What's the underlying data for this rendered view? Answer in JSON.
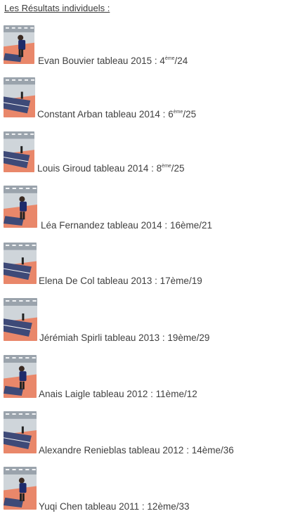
{
  "section": {
    "title": "Les Résultats individuels :"
  },
  "results": [
    {
      "name": "Evan Bouvier",
      "category": "tableau 2015",
      "rank": "4",
      "rank_suffix": "ème",
      "total": "/24",
      "photo": "player-photo"
    },
    {
      "name": "Constant Arban",
      "category": "tableau 2014",
      "rank": "6",
      "rank_suffix": "ème",
      "total": "/25",
      "photo": "table-photo"
    },
    {
      "name": "Louis Giroud",
      "category": "tableau 2014",
      "rank": "8",
      "rank_suffix": "ème",
      "total": "/25",
      "photo": "table-photo"
    },
    {
      "name": "Léa Fernandez",
      "category": "tableau 2014",
      "rank": "16ème",
      "rank_suffix": "",
      "total": "/21",
      "photo": "player-photo"
    },
    {
      "name": "Elena De Col",
      "category": "tableau 2013",
      "rank": "17ème",
      "rank_suffix": "",
      "total": "/19",
      "photo": "hall-photo"
    },
    {
      "name": "Jérémiah Spirli",
      "category": "tableau 2013",
      "rank": "19ème",
      "rank_suffix": "",
      "total": "/29",
      "photo": "hall-photo"
    },
    {
      "name": "Anais Laigle",
      "category": "tableau 2012",
      "rank": "11ème",
      "rank_suffix": "",
      "total": "/12",
      "photo": "player-photo"
    },
    {
      "name": "Alexandre Renieblas",
      "category": "tableau 2012",
      "rank": "14ème",
      "rank_suffix": "",
      "total": "/36",
      "photo": "hall-photo"
    },
    {
      "name": "Yuqi Chen",
      "category": "tableau 2011",
      "rank": "12ème",
      "rank_suffix": "",
      "total": "/33",
      "photo": "player-photo"
    }
  ],
  "colors": {
    "text": "#3f3f3f",
    "floor": "#e9876a",
    "table": "#3e4a78",
    "wall": "#cfd5da"
  }
}
